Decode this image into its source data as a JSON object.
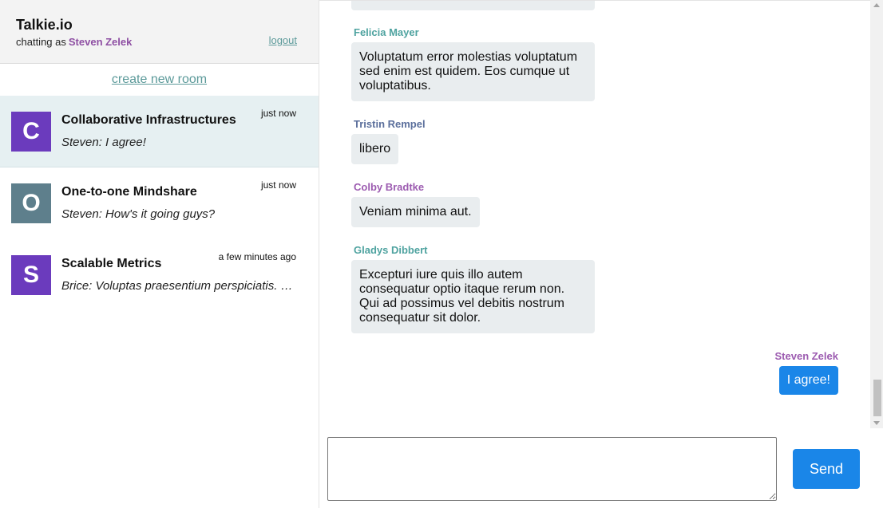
{
  "app": {
    "title": "Talkie.io",
    "chatting_as_label": "chatting as",
    "current_user": "Steven Zelek",
    "logout_label": "logout"
  },
  "sidebar": {
    "create_room_label": "create new room",
    "rooms": [
      {
        "avatar_letter": "C",
        "avatar_color": "#6b3bbd",
        "name": "Collaborative Infrastructures",
        "preview": "Steven: I agree!",
        "time": "just now",
        "active": true
      },
      {
        "avatar_letter": "O",
        "avatar_color": "#5e7f8c",
        "name": "One-to-one Mindshare",
        "preview": "Steven: How's it going guys?",
        "time": "just now",
        "active": false
      },
      {
        "avatar_letter": "S",
        "avatar_color": "#6b3bbd",
        "name": "Scalable Metrics",
        "preview": "Brice: Voluptas praesentium perspiciatis. Quasi",
        "time": "a few minutes ago",
        "active": false
      }
    ]
  },
  "messages": [
    {
      "author": "Felicia Mayer",
      "author_color": "#4fa3a0",
      "lines": [
        "Voluptatum error molestias voluptatum",
        "sed enim est quidem. Eos cumque ut",
        "voluptatibus."
      ]
    },
    {
      "author": "Tristin Rempel",
      "author_color": "#5b6f9c",
      "lines": [
        "libero"
      ]
    },
    {
      "author": "Colby Bradtke",
      "author_color": "#9c5bb0",
      "lines": [
        "Veniam minima aut."
      ]
    },
    {
      "author": "Gladys Dibbert",
      "author_color": "#4fa3a0",
      "lines": [
        "Excepturi iure quis illo autem",
        "consequatur optio itaque rerum non.",
        "Qui ad possimus vel debitis nostrum",
        "consequatur sit dolor."
      ]
    }
  ],
  "own_message": {
    "author": "Steven Zelek",
    "author_color": "#9c5bb0",
    "text": "I agree!"
  },
  "composer": {
    "value": "",
    "send_label": "Send"
  },
  "colors": {
    "accent": "#1a86e8",
    "link": "#5c9a9a",
    "active_room_bg": "#e6f0f2",
    "bubble_bg": "#e9edef"
  }
}
